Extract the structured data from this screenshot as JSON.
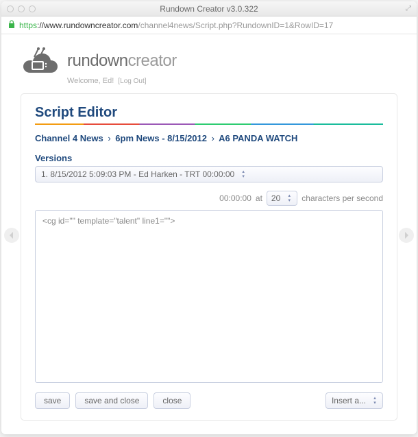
{
  "window": {
    "title": "Rundown Creator v3.0.322",
    "url_scheme": "https",
    "url_domain": "://www.rundowncreator.com",
    "url_path": "/channel4news/Script.php?RundownID=1&RowID=17"
  },
  "brand": {
    "name1": "rundown",
    "name2": "creator",
    "welcome": "Welcome, Ed!",
    "logout": "[Log Out]"
  },
  "panel": {
    "title": "Script Editor",
    "breadcrumb": {
      "part1": "Channel 4 News",
      "part2": "6pm News - 8/15/2012",
      "part3": "A6 PANDA WATCH"
    },
    "versions_label": "Versions",
    "version_selected": "1. 8/15/2012 5:09:03 PM - Ed Harken - TRT 00:00:00",
    "cps": {
      "trt": "00:00:00",
      "at": "at",
      "value": "20",
      "suffix": "characters per second"
    },
    "editor_content": "<cg id=\"\" template=\"talent\" line1=\"\">"
  },
  "buttons": {
    "save": "save",
    "save_close": "save and close",
    "close": "close",
    "insert": "Insert a..."
  }
}
